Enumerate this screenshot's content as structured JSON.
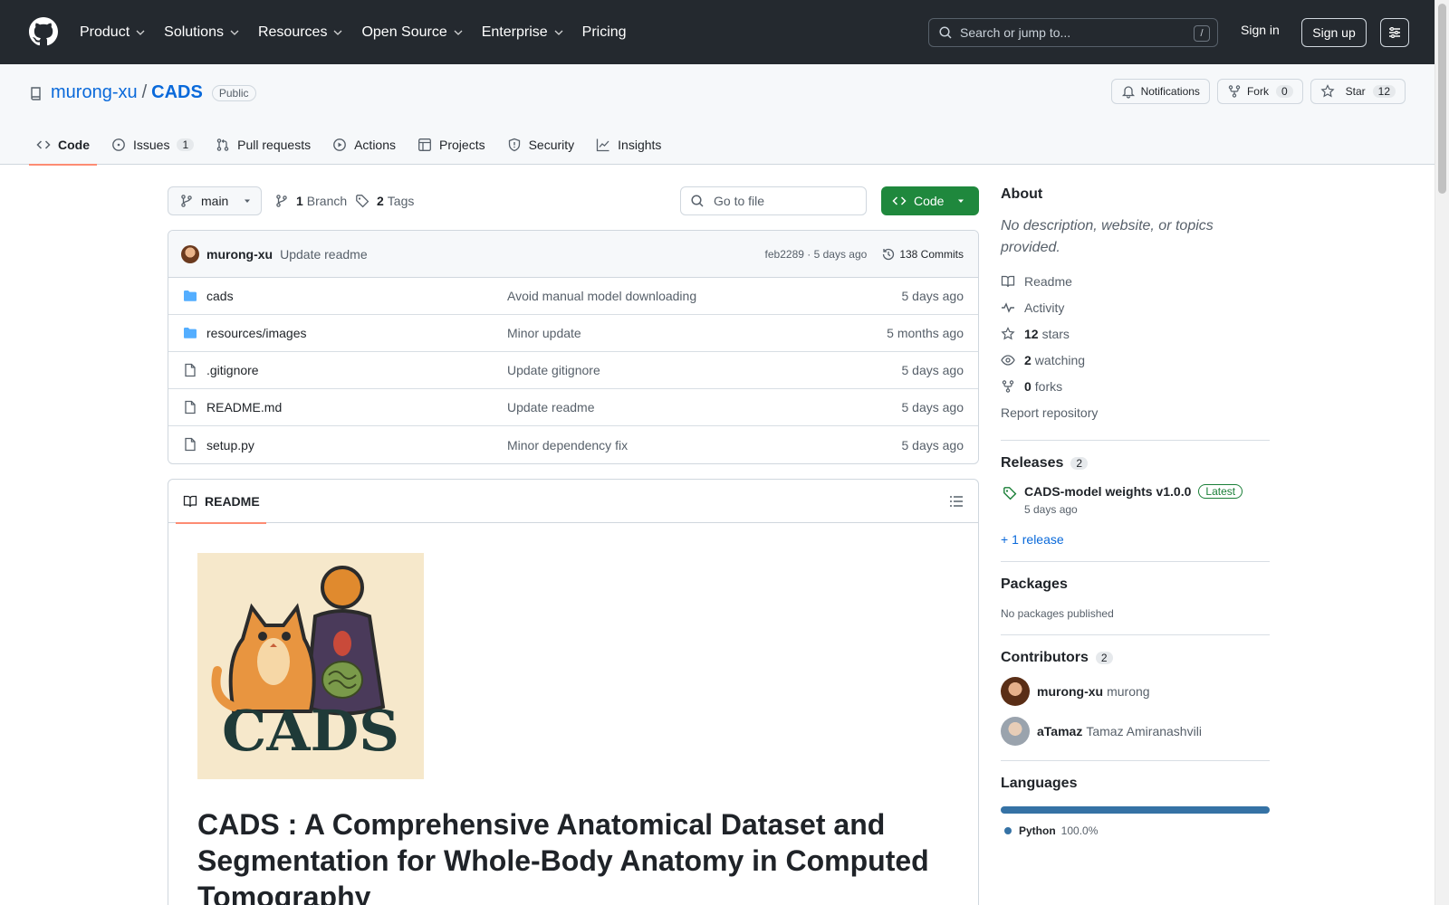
{
  "header": {
    "nav": [
      {
        "label": "Product",
        "dropdown": true
      },
      {
        "label": "Solutions",
        "dropdown": true
      },
      {
        "label": "Resources",
        "dropdown": true
      },
      {
        "label": "Open Source",
        "dropdown": true
      },
      {
        "label": "Enterprise",
        "dropdown": true
      },
      {
        "label": "Pricing",
        "dropdown": false
      }
    ],
    "search_placeholder": "Search or jump to...",
    "search_shortcut": "/",
    "signin": "Sign in",
    "signup": "Sign up"
  },
  "repo": {
    "owner": "murong-xu",
    "separator": "/",
    "name": "CADS",
    "visibility": "Public",
    "notifications": "Notifications",
    "fork_label": "Fork",
    "fork_count": "0",
    "star_label": "Star",
    "star_count": "12"
  },
  "tabs": [
    {
      "label": "Code",
      "icon": "code-icon",
      "active": true
    },
    {
      "label": "Issues",
      "icon": "issue-icon",
      "count": "1"
    },
    {
      "label": "Pull requests",
      "icon": "pull-request-icon"
    },
    {
      "label": "Actions",
      "icon": "play-icon"
    },
    {
      "label": "Projects",
      "icon": "table-icon"
    },
    {
      "label": "Security",
      "icon": "shield-icon"
    },
    {
      "label": "Insights",
      "icon": "graph-icon"
    }
  ],
  "branchbar": {
    "branch": "main",
    "branches_count": "1",
    "branches_label": "Branch",
    "tags_count": "2",
    "tags_label": "Tags",
    "goto_placeholder": "Go to file",
    "code_button": "Code"
  },
  "latest_commit": {
    "author": "murong-xu",
    "message": "Update readme",
    "hash_time": "feb2289 · 5 days ago",
    "commits": "138 Commits"
  },
  "files": [
    {
      "name": "cads",
      "type": "folder",
      "message": "Avoid manual model downloading",
      "age": "5 days ago"
    },
    {
      "name": "resources/images",
      "type": "folder",
      "message": "Minor update",
      "age": "5 months ago"
    },
    {
      "name": ".gitignore",
      "type": "file",
      "message": "Update gitignore",
      "age": "5 days ago"
    },
    {
      "name": "README.md",
      "type": "file",
      "message": "Update readme",
      "age": "5 days ago"
    },
    {
      "name": "setup.py",
      "type": "file",
      "message": "Minor dependency fix",
      "age": "5 days ago"
    }
  ],
  "readme": {
    "tab": "README",
    "logo_text": "CADS",
    "title": "CADS : A Comprehensive Anatomical Dataset and Segmentation for Whole-Body Anatomy in Computed Tomography"
  },
  "about": {
    "heading": "About",
    "description": "No description, website, or topics provided.",
    "links": [
      {
        "icon": "book-icon",
        "count": "",
        "label": "Readme"
      },
      {
        "icon": "pulse-icon",
        "count": "",
        "label": "Activity"
      },
      {
        "icon": "star-icon",
        "count": "12",
        "label": "stars"
      },
      {
        "icon": "eye-icon",
        "count": "2",
        "label": "watching"
      },
      {
        "icon": "fork-icon",
        "count": "0",
        "label": "forks"
      }
    ],
    "report": "Report repository"
  },
  "releases": {
    "heading": "Releases",
    "count": "2",
    "latest_name": "CADS-model weights v1.0.0",
    "latest_badge": "Latest",
    "latest_date": "5 days ago",
    "more": "+ 1 release"
  },
  "packages": {
    "heading": "Packages",
    "text": "No packages published"
  },
  "contributors": {
    "heading": "Contributors",
    "count": "2",
    "list": [
      {
        "login": "murong-xu",
        "name": "murong"
      },
      {
        "login": "aTamaz",
        "name": "Tamaz Amiranashvili"
      }
    ]
  },
  "languages": {
    "heading": "Languages",
    "items": [
      {
        "name": "Python",
        "percent": "100.0%",
        "color": "#3572a5"
      }
    ]
  },
  "colors": {
    "header_bg": "#24292f",
    "link": "#0969da",
    "primary_button": "#1f883d",
    "tab_underline": "#fd8c73"
  }
}
